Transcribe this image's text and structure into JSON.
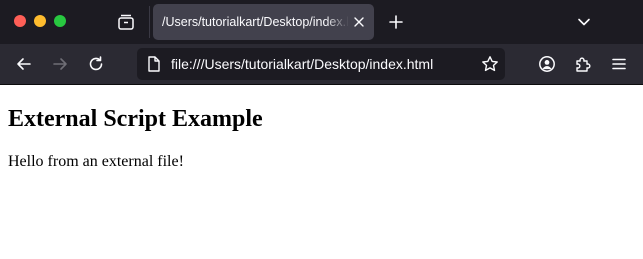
{
  "window": {
    "controls": [
      "close",
      "minimize",
      "maximize"
    ],
    "traffic_colors": {
      "close": "#fe5f57",
      "minimize": "#febc2e",
      "maximize": "#28c840"
    }
  },
  "tabs": [
    {
      "title": "/Users/tutorialkart/Desktop/index.html",
      "active": true,
      "icon": "close-icon"
    }
  ],
  "toolbar": {
    "icons": [
      "back-arrow-icon",
      "forward-arrow-icon",
      "reload-icon",
      "page-icon",
      "bookmark-star-icon",
      "account-icon",
      "extensions-icon",
      "menu-icon"
    ],
    "forward_enabled": false
  },
  "urlbar": {
    "url": "file:///Users/tutorialkart/Desktop/index.html"
  },
  "page": {
    "heading": "External Script Example",
    "paragraph": "Hello from an external file!"
  },
  "colors": {
    "tabbar_bg": "#1c1b22",
    "navbar_bg": "#2b2a33",
    "active_tab_bg": "#42414d",
    "urlbar_bg": "#1c1b22",
    "text_light": "#fbfbfe"
  }
}
